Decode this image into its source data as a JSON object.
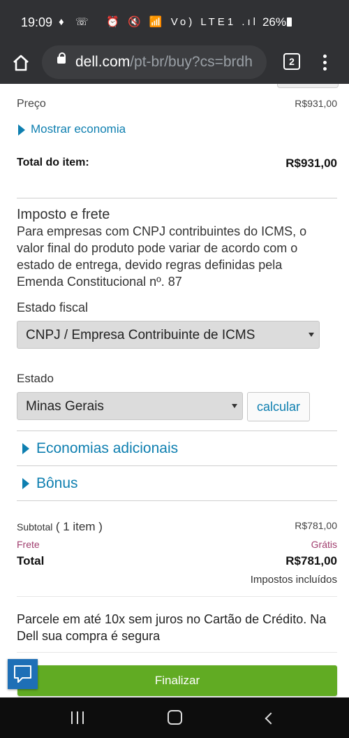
{
  "status_bar": {
    "time": "19:09",
    "app_icons": "♦ ☏",
    "system_icons": "⏰ 🔇 📶 Vo) LTE1 .ıl",
    "battery": "26%"
  },
  "browser": {
    "url_host": "dell.com",
    "url_path": "/pt-br/buy?cs=brdh",
    "tab_count": "2"
  },
  "summary": {
    "price_label": "Preço",
    "price_value": "R$931,00",
    "show_savings": "Mostrar economia",
    "item_total_label": "Total do item:",
    "item_total_value": "R$931,00"
  },
  "tax": {
    "title": "Imposto e frete",
    "description": "Para empresas com CNPJ contribuintes do ICMS, o valor final do produto pode variar de acordo com o estado de entrega, devido regras definidas pela Emenda Constitucional nº. 87",
    "fiscal_label": "Estado fiscal",
    "fiscal_value": "CNPJ / Empresa Contribuinte de ICMS",
    "state_label": "Estado",
    "state_value": "Minas Gerais",
    "calc_button": "calcular"
  },
  "accordions": {
    "additional_savings": "Economias adicionais",
    "bonus": "Bônus"
  },
  "totals": {
    "subtotal_label": "Subtotal",
    "subtotal_count": "( 1 item )",
    "subtotal_value": "R$781,00",
    "shipping_label": "Frete",
    "shipping_value": "Grátis",
    "total_label": "Total",
    "total_value": "R$781,00",
    "taxes_note": "Impostos incluídos"
  },
  "installments": "Parcele em até 10x sem juros no Cartão de Crédito. Na Dell sua compra é segura",
  "finalize_button": "Finalizar",
  "colors": {
    "link": "#0e7fb0",
    "finalize": "#61ab23",
    "shipping": "#a03d6e",
    "chat": "#1e6fb6",
    "chrome": "#303134"
  }
}
